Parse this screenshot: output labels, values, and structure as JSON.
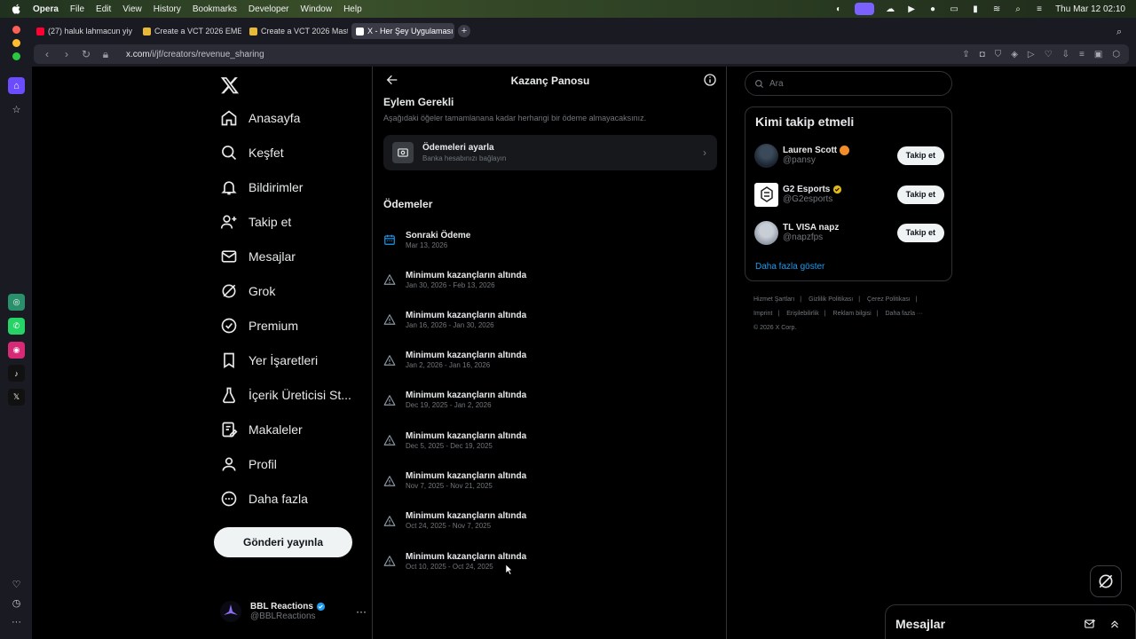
{
  "menubar": {
    "app_name": "Opera",
    "items": [
      "File",
      "Edit",
      "View",
      "History",
      "Bookmarks",
      "Developer",
      "Window",
      "Help"
    ],
    "clock": "Thu Mar 12  02:10"
  },
  "tabs": [
    {
      "label": "(27) haluk lahmacun yiy",
      "favicon_color": "#ff0033"
    },
    {
      "label": "Create a VCT 2026 EME",
      "favicon_color": "#e8b838"
    },
    {
      "label": "Create a VCT 2026 Mast",
      "favicon_color": "#e8b838"
    },
    {
      "label": "X - Her Şey Uygulaması",
      "favicon_color": "#ffffff"
    }
  ],
  "address": {
    "host": "x.com",
    "path": "/i/jf/creators/revenue_sharing"
  },
  "nav": {
    "home": "Anasayfa",
    "explore": "Keşfet",
    "notifications": "Bildirimler",
    "follow": "Takip et",
    "messages": "Mesajlar",
    "grok": "Grok",
    "premium": "Premium",
    "bookmarks": "Yer İşaretleri",
    "creator": "İçerik Üreticisi St...",
    "articles": "Makaleler",
    "profile": "Profil",
    "more": "Daha fazla",
    "post_button": "Gönderi yayınla"
  },
  "account": {
    "name": "BBL Reactions",
    "handle": "@BBLReactions"
  },
  "center": {
    "title": "Kazanç Panosu",
    "action_title": "Eylem Gerekli",
    "action_sub": "Aşağıdaki öğeler tamamlanana kadar herhangi bir ödeme almayacaksınız.",
    "setup_title": "Ödemeleri ayarla",
    "setup_sub": "Banka hesabınızı bağlayın",
    "payouts_title": "Ödemeler",
    "next_payout": {
      "title": "Sonraki Ödeme",
      "date": "Mar 13, 2026"
    },
    "payouts": [
      {
        "title": "Minimum kazançların altında",
        "date": "Jan 30, 2026 - Feb 13, 2026"
      },
      {
        "title": "Minimum kazançların altında",
        "date": "Jan 16, 2026 - Jan 30, 2026"
      },
      {
        "title": "Minimum kazançların altında",
        "date": "Jan 2, 2026 - Jan 16, 2026"
      },
      {
        "title": "Minimum kazançların altında",
        "date": "Dec 19, 2025 - Jan 2, 2026"
      },
      {
        "title": "Minimum kazançların altında",
        "date": "Dec 5, 2025 - Dec 19, 2025"
      },
      {
        "title": "Minimum kazançların altında",
        "date": "Nov 7, 2025 - Nov 21, 2025"
      },
      {
        "title": "Minimum kazançların altında",
        "date": "Oct 24, 2025 - Nov 7, 2025"
      },
      {
        "title": "Minimum kazançların altında",
        "date": "Oct 10, 2025 - Oct 24, 2025"
      }
    ]
  },
  "right": {
    "search_placeholder": "Ara",
    "wtf_title": "Kimi takip etmeli",
    "users": [
      {
        "name": "Lauren Scott",
        "handle": "@pansy",
        "follow": "Takip et"
      },
      {
        "name": "G2 Esports",
        "handle": "@G2esports",
        "follow": "Takip et"
      },
      {
        "name": "TL VISA napz",
        "handle": "@napzfps",
        "follow": "Takip et"
      }
    ],
    "show_more": "Daha fazla göster",
    "footer": [
      "Hizmet Şartları",
      "|",
      "Gizlilik Politikası",
      "|",
      "Çerez Politikası",
      "|",
      "Imprint",
      "|",
      "Erişilebilirlik",
      "|",
      "Reklam bilgisi",
      "|",
      "Daha fazla ···",
      "© 2026 X Corp."
    ]
  },
  "drawer": {
    "title": "Mesajlar"
  }
}
